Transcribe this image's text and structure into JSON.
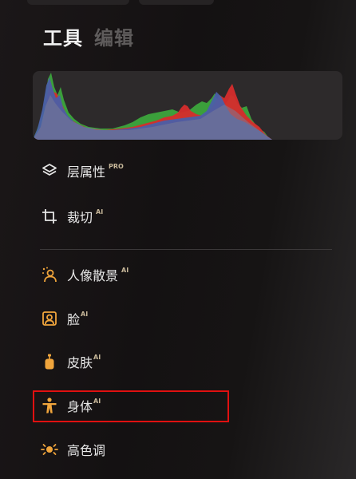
{
  "tabs": [
    {
      "label": "工具",
      "active": true
    },
    {
      "label": "编辑",
      "active": false
    }
  ],
  "histogram": {
    "channels": [
      "red",
      "green",
      "blue",
      "luminance"
    ],
    "colors": {
      "red": "#d62c2c",
      "green": "#3ca53c",
      "blue": "#4a5fa8",
      "luminance": "#6f6f8a"
    }
  },
  "menu": {
    "section1": [
      {
        "label": "层属性",
        "badge": "PRO",
        "icon": "layers-icon"
      },
      {
        "label": "裁切",
        "badge": "AI",
        "icon": "crop-icon"
      }
    ],
    "section2": [
      {
        "label": "人像散景",
        "badge": "AI",
        "icon": "portrait-bokeh-icon"
      },
      {
        "label": "脸",
        "badge": "AI",
        "icon": "face-icon"
      },
      {
        "label": "皮肤",
        "badge": "AI",
        "icon": "skin-icon"
      },
      {
        "label": "身体",
        "badge": "AI",
        "icon": "body-icon",
        "highlighted": true
      },
      {
        "label": "高色调",
        "badge": "",
        "icon": "high-key-icon"
      }
    ]
  },
  "colors": {
    "accent": "#f0a53c",
    "highlight_border": "#e01010",
    "text": "#e8e8e8",
    "badge": "#c8b89a"
  }
}
